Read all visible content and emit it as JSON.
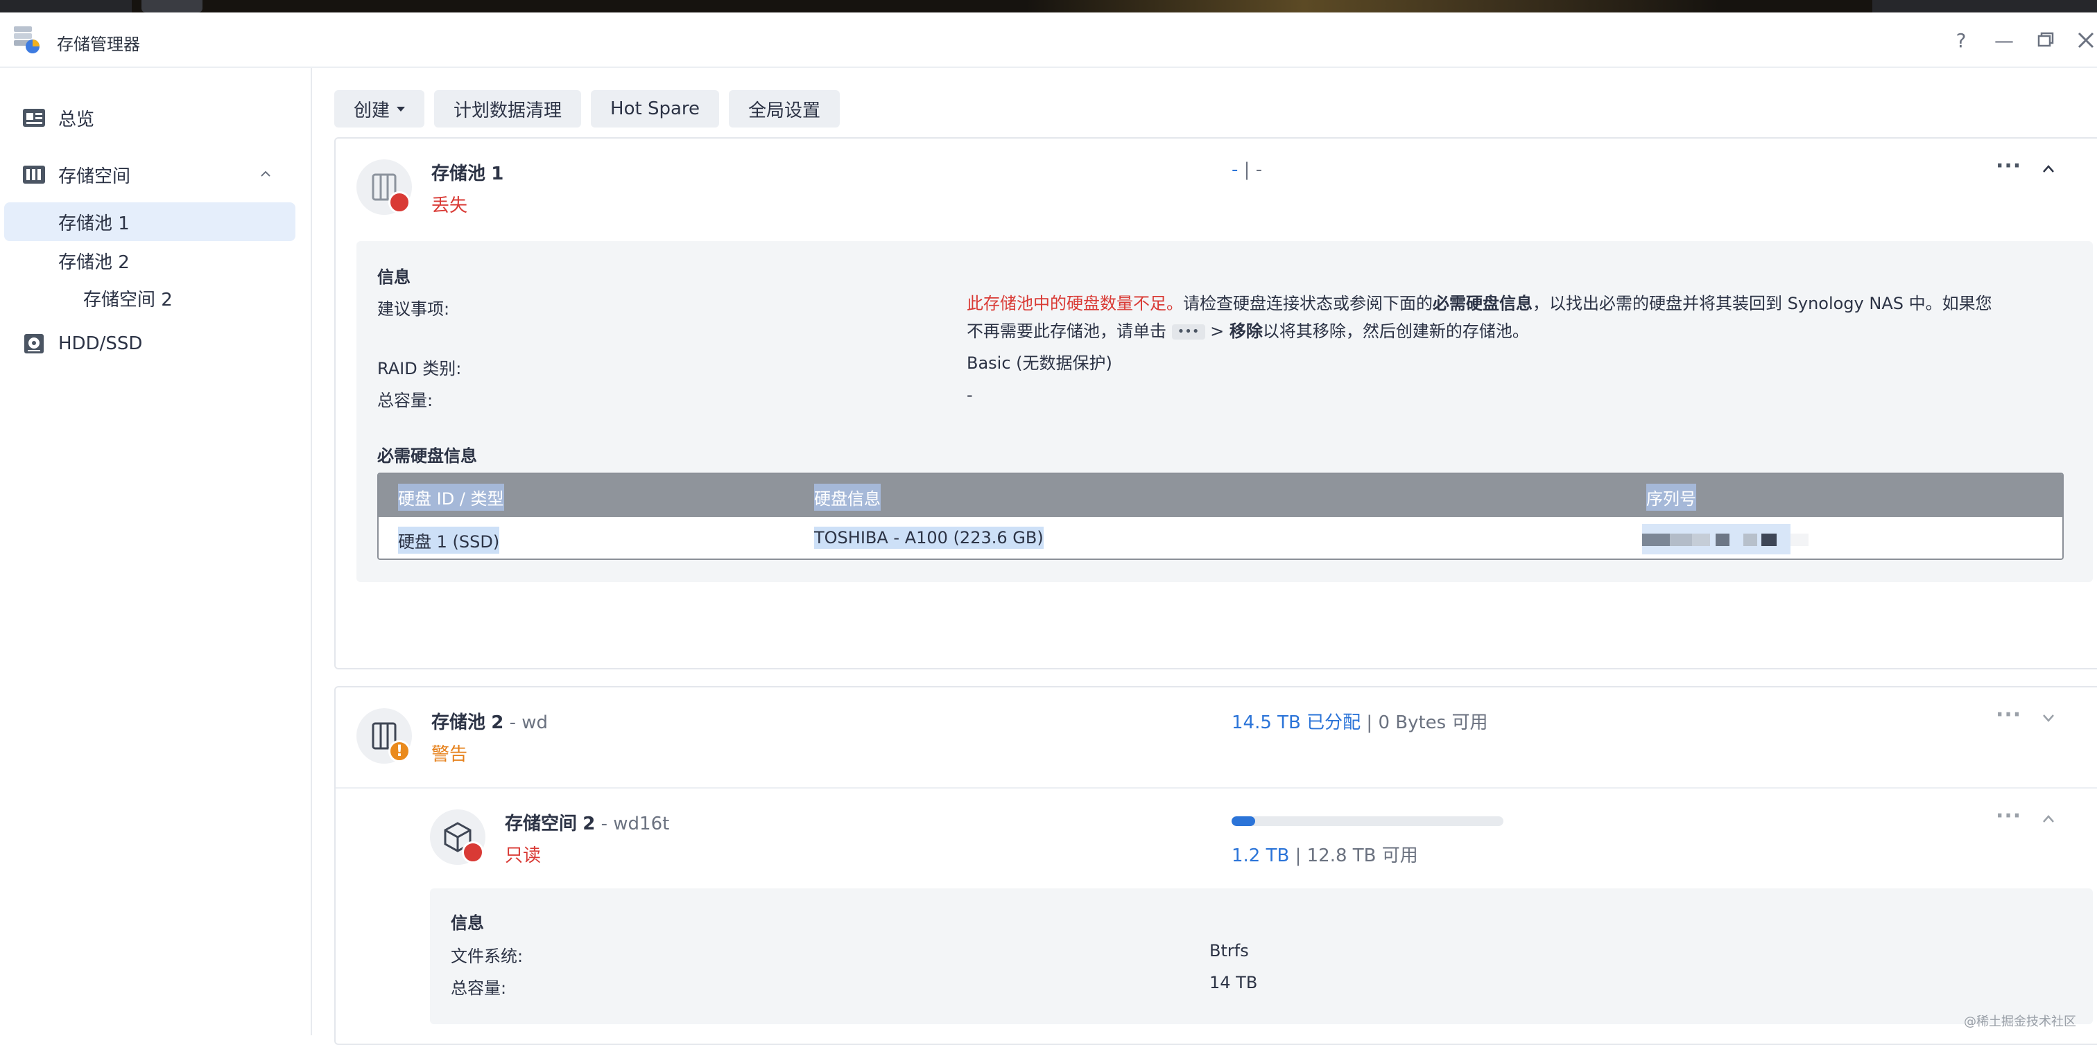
{
  "window": {
    "title": "存储管理器",
    "help": "?",
    "minimize": "—"
  },
  "sidebar": {
    "overview": "总览",
    "storage": "存储空间",
    "pool1": "存储池 1",
    "pool2": "存储池 2",
    "volume2": "存储空间 2",
    "hdd": "HDD/SSD"
  },
  "toolbar": {
    "create": "创建",
    "schedule": "计划数据清理",
    "hotspare": "Hot Spare",
    "global": "全局设置"
  },
  "pool1": {
    "name": "存储池",
    "num": "1",
    "status": "丢失",
    "usage_a": "-",
    "usage_sep": "|",
    "usage_b": "-",
    "more": "···",
    "info": {
      "heading": "信息",
      "advice_label": "建议事项:",
      "advice_red": "此存储池中的硬盘数量不足。",
      "advice_1": "请检查硬盘连接状态或参阅下面的",
      "advice_bold1": "必需硬盘信息",
      "advice_2": "，以找出必需的硬盘并将其装回到 Synology NAS 中。如果您",
      "advice_3": "不再需要此存储池，请单击",
      "advice_chip": "•••",
      "advice_4": " > ",
      "advice_bold2": "移除",
      "advice_5": "以将其移除，然后创建新的存储池。",
      "raid_label": "RAID 类别:",
      "raid_value": "Basic (无数据保护)",
      "cap_label": "总容量:",
      "cap_value": "-",
      "disk_heading": "必需硬盘信息",
      "table": {
        "headers": [
          "硬盘 ID / 类型",
          "硬盘信息",
          "序列号"
        ],
        "rows": [
          [
            "硬盘 1 (SSD)",
            "TOSHIBA - A100 (223.6 GB)",
            ""
          ]
        ]
      }
    }
  },
  "pool2": {
    "name": "存储池",
    "num": "2",
    "desc": " - wd",
    "status": "警告",
    "alloc": "14.5 TB 已分配",
    "sep": "|",
    "avail": "0 Bytes 可用",
    "more": "···"
  },
  "volume2": {
    "name": "存储空间",
    "num": "2",
    "desc": " - wd16t",
    "status": "只读",
    "used": "1.2 TB",
    "sep": "|",
    "avail": "12.8 TB 可用",
    "usage_fraction": 0.086,
    "more": "···",
    "info": {
      "heading": "信息",
      "fs_label": "文件系统:",
      "fs_value": "Btrfs",
      "cap_label": "总容量:",
      "cap_value": "14 TB"
    }
  },
  "watermark": "@稀土掘金技术社区",
  "colors": {
    "accent": "#2b74d8",
    "danger": "#d93a35",
    "warning": "#ea8a1c",
    "active_bg": "#e5eefb"
  }
}
